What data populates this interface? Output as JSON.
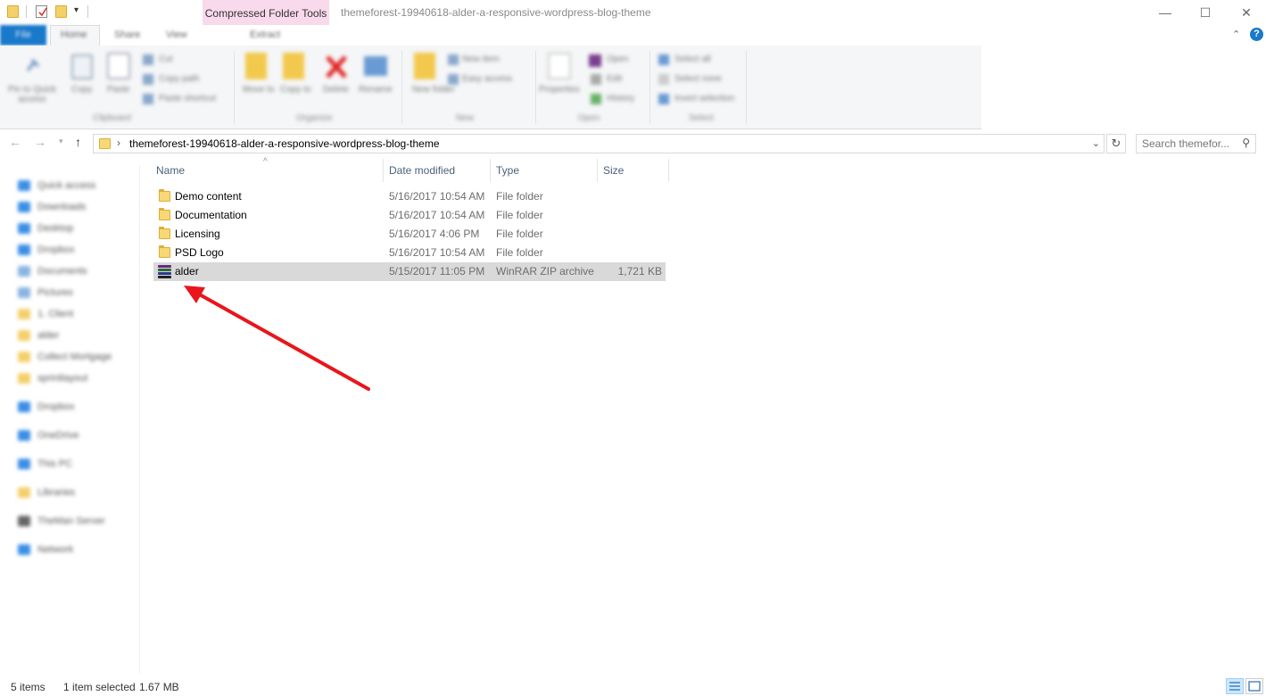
{
  "titlebar": {
    "contextual_tab": "Compressed Folder Tools",
    "window_title": "themeforest-19940618-alder-a-responsive-wordpress-blog-theme",
    "minimize": "—",
    "maximize": "☐",
    "close": "✕"
  },
  "ribbon_tabs": {
    "file": "File",
    "home": "Home",
    "share": "Share",
    "view": "View",
    "extract": "Extract"
  },
  "ribbon": {
    "clipboard": {
      "pin": "Pin to Quick access",
      "copy": "Copy",
      "paste": "Paste",
      "cut": "Cut",
      "copy_path": "Copy path",
      "paste_shortcut": "Paste shortcut",
      "group": "Clipboard"
    },
    "organize": {
      "move_to": "Move to",
      "copy_to": "Copy to",
      "delete": "Delete",
      "rename": "Rename",
      "group": "Organize"
    },
    "new": {
      "new_folder": "New folder",
      "new_item": "New item",
      "easy_access": "Easy access",
      "group": "New"
    },
    "open": {
      "properties": "Properties",
      "open": "Open",
      "edit": "Edit",
      "history": "History",
      "group": "Open"
    },
    "select": {
      "select_all": "Select all",
      "select_none": "Select none",
      "invert": "Invert selection",
      "group": "Select"
    }
  },
  "address": {
    "path": "themeforest-19940618-alder-a-responsive-wordpress-blog-theme",
    "search_placeholder": "Search themefor..."
  },
  "navpane": {
    "items": [
      {
        "label": "Quick access",
        "color": "#3a8ee6"
      },
      {
        "label": "Downloads",
        "color": "#3a8ee6"
      },
      {
        "label": "Desktop",
        "color": "#3a8ee6"
      },
      {
        "label": "Dropbox",
        "color": "#3a8ee6"
      },
      {
        "label": "Documents",
        "color": "#8ab4e0"
      },
      {
        "label": "Pictures",
        "color": "#8ab4e0"
      },
      {
        "label": "1. Client",
        "color": "#f4d06b"
      },
      {
        "label": "alder",
        "color": "#f4d06b"
      },
      {
        "label": "Collect Mortgage",
        "color": "#f4d06b"
      },
      {
        "label": "sprintlayout",
        "color": "#f4d06b"
      },
      {
        "label": "Dropbox",
        "color": "#3a8ee6"
      },
      {
        "label": "OneDrive",
        "color": "#3a8ee6"
      },
      {
        "label": "This PC",
        "color": "#3a8ee6"
      },
      {
        "label": "Libraries",
        "color": "#f4d06b"
      },
      {
        "label": "TheMan Server",
        "color": "#666666"
      },
      {
        "label": "Network",
        "color": "#3a8ee6"
      }
    ]
  },
  "columns": {
    "name": "Name",
    "date": "Date modified",
    "type": "Type",
    "size": "Size"
  },
  "files": [
    {
      "name": "Demo content",
      "date": "5/16/2017 10:54 AM",
      "type": "File folder",
      "size": ""
    },
    {
      "name": "Documentation",
      "date": "5/16/2017 10:54 AM",
      "type": "File folder",
      "size": ""
    },
    {
      "name": "Licensing",
      "date": "5/16/2017 4:06 PM",
      "type": "File folder",
      "size": ""
    },
    {
      "name": "PSD Logo",
      "date": "5/16/2017 10:54 AM",
      "type": "File folder",
      "size": ""
    },
    {
      "name": "alder",
      "date": "5/15/2017 11:05 PM",
      "type": "WinRAR ZIP archive",
      "size": "1,721 KB"
    }
  ],
  "status": {
    "items": "5 items",
    "selected": "1 item selected",
    "selected_size": "1.67 MB"
  },
  "colors": {
    "accent": "#1979ca",
    "annotation_arrow": "#e8161b",
    "selection": "#d9d9d9"
  }
}
